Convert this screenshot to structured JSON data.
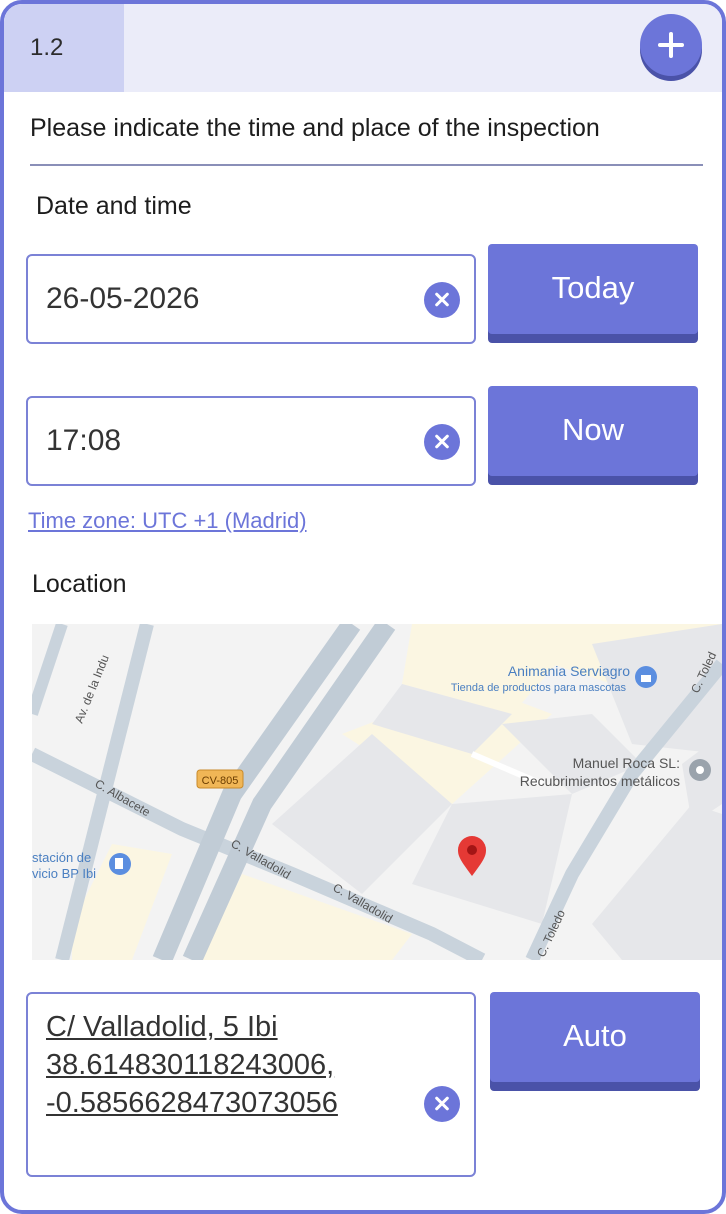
{
  "header": {
    "step": "1.2",
    "add_icon": "plus-icon"
  },
  "question": "Please indicate the time and place of the inspection",
  "datetime": {
    "label": "Date and time",
    "date_value": "26-05-2026",
    "date_button": "Today",
    "time_value": "17:08",
    "time_button": "Now",
    "timezone": "Time zone: UTC +1 (Madrid)"
  },
  "location": {
    "label": "Location",
    "map": {
      "streets": [
        "Av. de la Indu",
        "C. Albacete",
        "C. Valladolid",
        "C. Valladolid",
        "C. Toledo",
        "C. Toled"
      ],
      "road_badge": "CV-805",
      "pois": [
        {
          "name": "Animania Serviagro",
          "subtitle": "Tienda de productos para mascotas"
        },
        {
          "name": "Manuel Roca SL:",
          "subtitle": "Recubrimientos metálicos"
        },
        {
          "name": "stación de",
          "subtitle": "vicio BP Ibi"
        }
      ],
      "pin_icon": "map-pin-icon"
    },
    "address_lines": [
      "C/ Valladolid, 5 Ibi",
      "38.614830118243006,",
      "-0.5856628473073056"
    ],
    "auto_button": "Auto"
  },
  "colors": {
    "accent": "#6c75d9",
    "accent_dark": "#4a52a8",
    "header_bg": "#ebecf9",
    "tab_bg": "#cdd1f3"
  }
}
